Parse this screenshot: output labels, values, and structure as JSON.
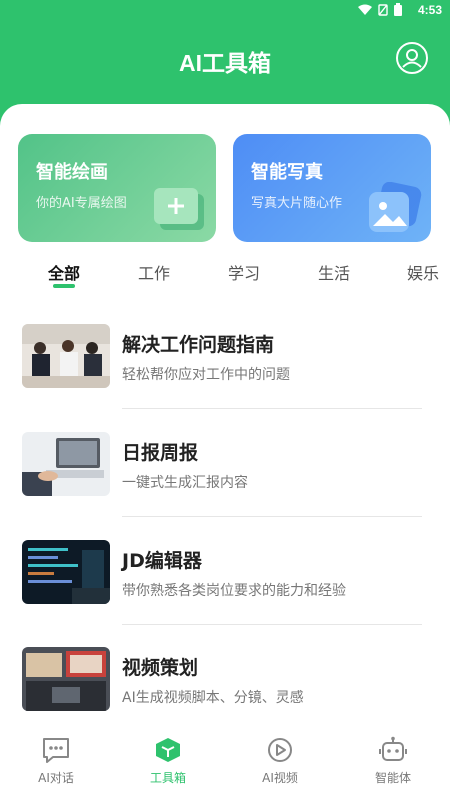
{
  "status": {
    "time": "4:53"
  },
  "header": {
    "title": "AI工具箱"
  },
  "cards": [
    {
      "title": "智能绘画",
      "subtitle": "你的AI专属绘图"
    },
    {
      "title": "智能写真",
      "subtitle": "写真大片随心作"
    }
  ],
  "tabs": [
    "全部",
    "工作",
    "学习",
    "生活",
    "娱乐"
  ],
  "items": [
    {
      "title": "解决工作问题指南",
      "subtitle": "轻松帮你应对工作中的问题"
    },
    {
      "title": "日报周报",
      "subtitle": "一键式生成汇报内容"
    },
    {
      "title": "JD编辑器",
      "subtitle": "带你熟悉各类岗位要求的能力和经验"
    },
    {
      "title": "视频策划",
      "subtitle": "AI生成视频脚本、分镜、灵感"
    }
  ],
  "nav": [
    {
      "label": "AI对话",
      "icon": "chat-icon"
    },
    {
      "label": "工具箱",
      "icon": "toolbox-icon"
    },
    {
      "label": "AI视频",
      "icon": "play-icon"
    },
    {
      "label": "智能体",
      "icon": "robot-icon"
    }
  ],
  "colors": {
    "accent": "#2ec26d",
    "card_green": "#6fcf97",
    "card_blue": "#5a9cf6"
  }
}
